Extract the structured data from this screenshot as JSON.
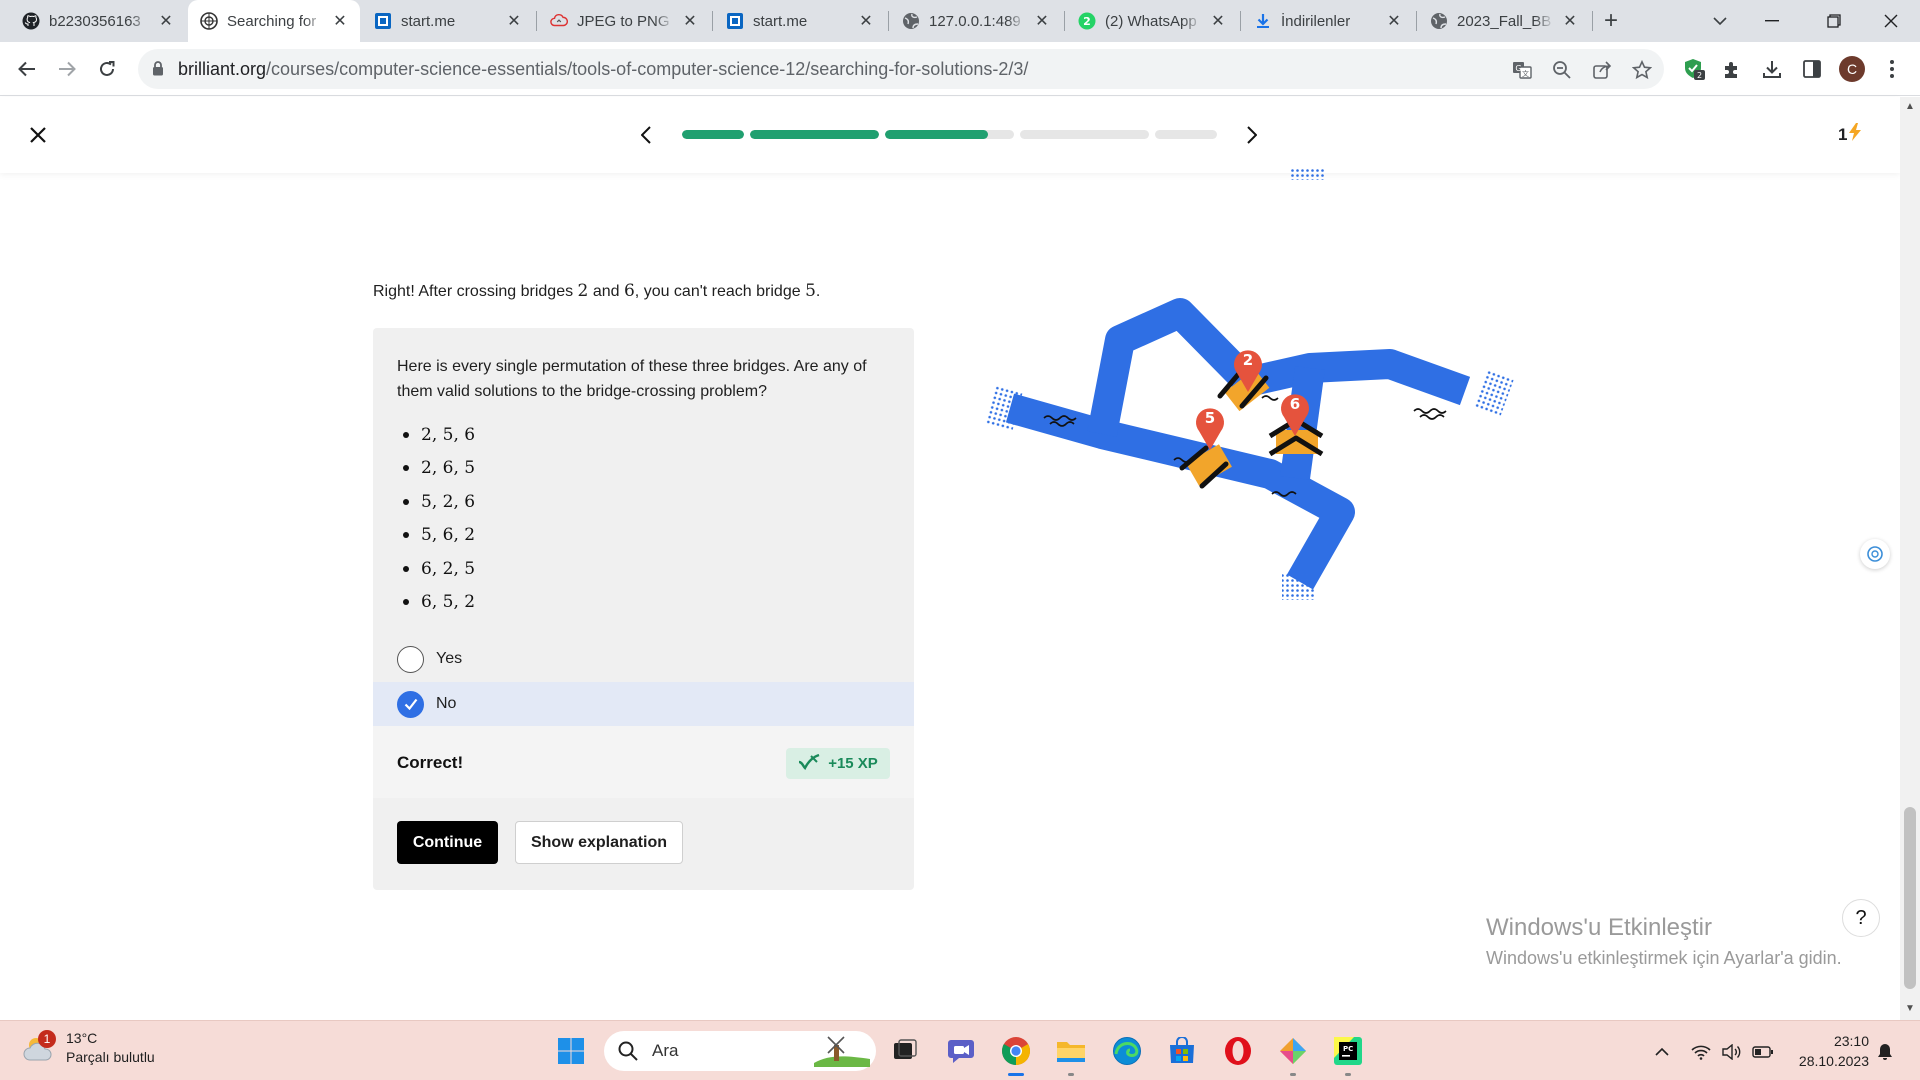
{
  "browser": {
    "tabs": [
      {
        "title": "b2230356163",
        "favicon": "github-icon",
        "active": false
      },
      {
        "title": "Searching for",
        "favicon": "brilliant-icon",
        "active": true
      },
      {
        "title": "start.me",
        "favicon": "startme-icon",
        "active": false
      },
      {
        "title": "JPEG to PNG",
        "favicon": "cloud-convert-icon",
        "active": false
      },
      {
        "title": "start.me",
        "favicon": "startme-icon",
        "active": false
      },
      {
        "title": "127.0.0.1:489",
        "favicon": "globe-icon",
        "active": false
      },
      {
        "title": "(2) WhatsApp",
        "favicon": "whatsapp-icon",
        "active": false,
        "badge": "2"
      },
      {
        "title": "İndirilenler",
        "favicon": "download-icon",
        "active": false
      },
      {
        "title": "2023_Fall_BB",
        "favicon": "globe-icon",
        "active": false
      }
    ],
    "url_host": "brilliant.org",
    "url_path": "/courses/computer-science-essentials/tools-of-computer-science-12/searching-for-solutions-2/3/",
    "extension_badge": "2",
    "profile_initial": "C"
  },
  "lesson": {
    "progress": [
      {
        "fill": 1.0
      },
      {
        "fill": 1.0
      },
      {
        "fill": 0.8
      },
      {
        "fill": 0.0
      },
      {
        "fill": 0.0
      }
    ],
    "streak_count": "1",
    "feedback_prefix": "Right! After crossing bridges ",
    "feedback_b1": "2",
    "feedback_and": " and ",
    "feedback_b2": "6",
    "feedback_mid": ", you can't reach bridge ",
    "feedback_b3": "5",
    "feedback_end": ".",
    "question": "Here is every single permutation of these three bridges. Are any of them valid solutions to the bridge-crossing problem?",
    "permutations": [
      "2, 5, 6",
      "2, 6, 5",
      "5, 2, 6",
      "5, 6, 2",
      "6, 2, 5",
      "6, 5, 2"
    ],
    "choices": [
      {
        "label": "Yes",
        "selected": false
      },
      {
        "label": "No",
        "selected": true
      }
    ],
    "result": "Correct!",
    "xp": "+15 XP",
    "continue_label": "Continue",
    "explain_label": "Show explanation",
    "map_pins": [
      "2",
      "6",
      "5"
    ],
    "help_label": "?"
  },
  "windows_activation": {
    "title": "Windows'u Etkinleştir",
    "subtitle": "Windows'u etkinleştirmek için Ayarlar'a gidin."
  },
  "taskbar": {
    "weather_temp": "13°C",
    "weather_desc": "Parçalı bulutlu",
    "weather_badge": "1",
    "search_placeholder": "Ara",
    "time": "23:10",
    "date": "28.10.2023"
  },
  "colors": {
    "accent_green": "#20a070",
    "river_blue": "#2f6fe4",
    "bridge_orange": "#f2a52b",
    "pin_red": "#e5533d"
  }
}
